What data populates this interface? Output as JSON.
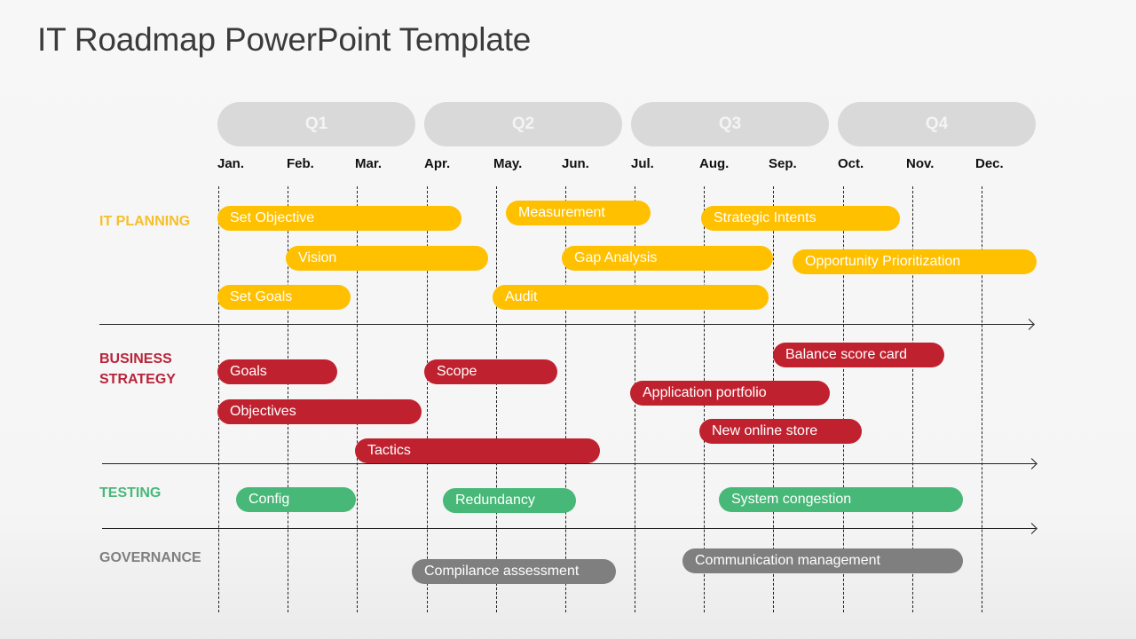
{
  "title": "IT Roadmap PowerPoint Template",
  "quarters": [
    "Q1",
    "Q2",
    "Q3",
    "Q4"
  ],
  "months": [
    "Jan.",
    "Feb.",
    "Mar.",
    "Apr.",
    "May.",
    "Jun.",
    "Jul.",
    "Aug.",
    "Sep.",
    "Oct.",
    "Nov.",
    "Dec."
  ],
  "colors": {
    "it_planning": "#ffc000",
    "business_strategy": "#c0212f",
    "testing": "#47b878",
    "governance": "#7f7f7f",
    "quarter_pill": "#d9d9d9"
  },
  "categories": {
    "it_planning": "IT PLANNING",
    "business_strategy": "BUSINESS STRATEGY",
    "testing": "TESTING",
    "governance": "GOVERNANCE"
  },
  "tasks": {
    "it_planning": [
      {
        "label": "Set Objective",
        "start_month": 1.0,
        "end_month": 4.5
      },
      {
        "label": "Vision",
        "start_month": 2.0,
        "end_month": 5.9
      },
      {
        "label": "Set Goals",
        "start_month": 1.0,
        "end_month": 2.9
      },
      {
        "label": "Measurement",
        "start_month": 5.1,
        "end_month": 7.2
      },
      {
        "label": "Gap Analysis",
        "start_month": 5.9,
        "end_month": 9.0
      },
      {
        "label": "Audit",
        "start_month": 4.9,
        "end_month": 8.9
      },
      {
        "label": "Strategic Intents",
        "start_month": 8.0,
        "end_month": 10.8
      },
      {
        "label": "Opportunity Prioritization",
        "start_month": 9.3,
        "end_month": 12.8
      }
    ],
    "business_strategy": [
      {
        "label": "Goals",
        "start_month": 1.0,
        "end_month": 2.7
      },
      {
        "label": "Objectives",
        "start_month": 1.0,
        "end_month": 3.9
      },
      {
        "label": "Tactics",
        "start_month": 3.0,
        "end_month": 6.5
      },
      {
        "label": "Scope",
        "start_month": 4.0,
        "end_month": 5.9
      },
      {
        "label": "Balance score card",
        "start_month": 9.0,
        "end_month": 11.4
      },
      {
        "label": "Application portfolio",
        "start_month": 7.0,
        "end_month": 9.8
      },
      {
        "label": "New online store",
        "start_month": 8.0,
        "end_month": 10.2
      }
    ],
    "testing": [
      {
        "label": "Config",
        "start_month": 1.3,
        "end_month": 3.0
      },
      {
        "label": "Redundancy",
        "start_month": 4.2,
        "end_month": 6.1
      },
      {
        "label": "System congestion",
        "start_month": 8.2,
        "end_month": 11.7
      }
    ],
    "governance": [
      {
        "label": "Compilance assessment",
        "start_month": 3.8,
        "end_month": 6.7
      },
      {
        "label": "Communication management",
        "start_month": 7.7,
        "end_month": 11.7
      }
    ]
  }
}
